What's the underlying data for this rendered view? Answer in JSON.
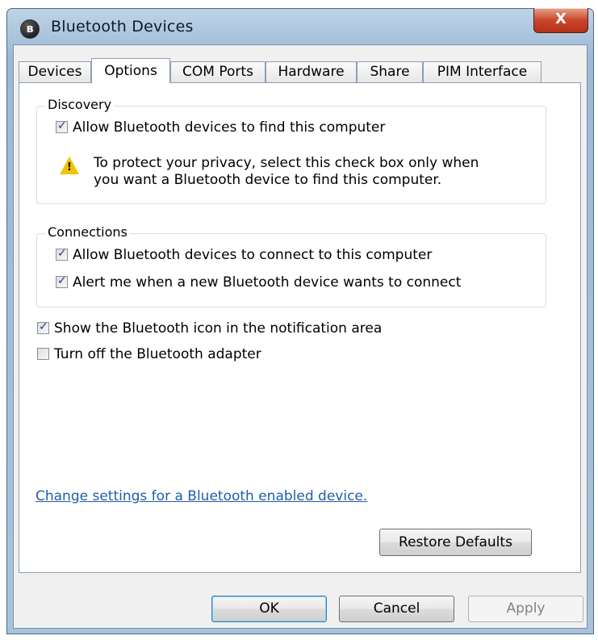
{
  "window": {
    "title": "Bluetooth Devices",
    "close_label": "X"
  },
  "tabs": [
    {
      "label": "Devices"
    },
    {
      "label": "Options"
    },
    {
      "label": "COM Ports"
    },
    {
      "label": "Hardware"
    },
    {
      "label": "Share"
    },
    {
      "label": "PIM Interface"
    }
  ],
  "active_tab": "Options",
  "discovery": {
    "legend": "Discovery",
    "allow_find": {
      "label": "Allow Bluetooth devices to find this computer",
      "checked": true
    },
    "warning_line1": "To protect your privacy, select this check box only when",
    "warning_line2": "you want a Bluetooth device to find this computer."
  },
  "connections": {
    "legend": "Connections",
    "allow_connect": {
      "label": "Allow Bluetooth devices to connect to this computer",
      "checked": true
    },
    "alert_connect": {
      "label": "Alert me when a new Bluetooth device wants to connect",
      "checked": true
    }
  },
  "show_icon": {
    "label": "Show the Bluetooth icon in the notification area",
    "checked": true
  },
  "turn_off": {
    "label": "Turn off the Bluetooth adapter",
    "checked": false
  },
  "change_settings_link": "Change settings for a Bluetooth enabled device.",
  "buttons": {
    "restore": "Restore Defaults",
    "ok": "OK",
    "cancel": "Cancel",
    "apply": "Apply"
  },
  "icons": {
    "window_icon": "bluetooth-icon",
    "warning": "warning-icon"
  }
}
